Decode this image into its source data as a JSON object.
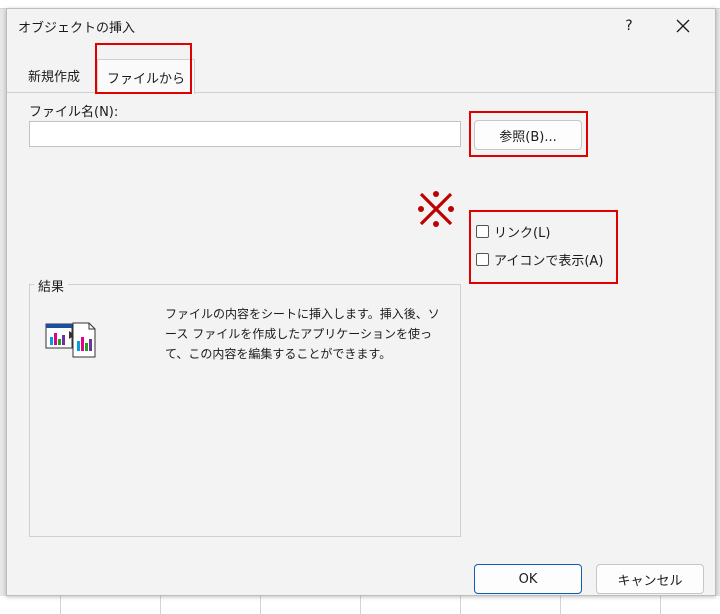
{
  "dialog": {
    "title": "オブジェクトの挿入",
    "help_label": "?",
    "close_label": "✕"
  },
  "tabs": [
    {
      "label": "新規作成",
      "selected": false
    },
    {
      "label": "ファイルから",
      "selected": true
    }
  ],
  "file_name": {
    "label": "ファイル名(N):",
    "value": "",
    "placeholder": ""
  },
  "browse_button": {
    "label": "参照(B)..."
  },
  "annotation_mark": "※",
  "options": {
    "link": {
      "label": "リンク(L)",
      "checked": false
    },
    "display_as_icon": {
      "label": "アイコンで表示(A)",
      "checked": false
    }
  },
  "result": {
    "legend": "結果",
    "description": "ファイルの内容をシートに挿入します。挿入後、ソース ファイルを作成したアプリケーションを使って、この内容を編集することができます。",
    "icon": "embedded-file-icon"
  },
  "footer": {
    "ok_label": "OK",
    "cancel_label": "キャンセル"
  },
  "colors": {
    "highlight_red": "#e00000",
    "annotation_red": "#c00000",
    "ok_border": "#0a5fb4"
  }
}
